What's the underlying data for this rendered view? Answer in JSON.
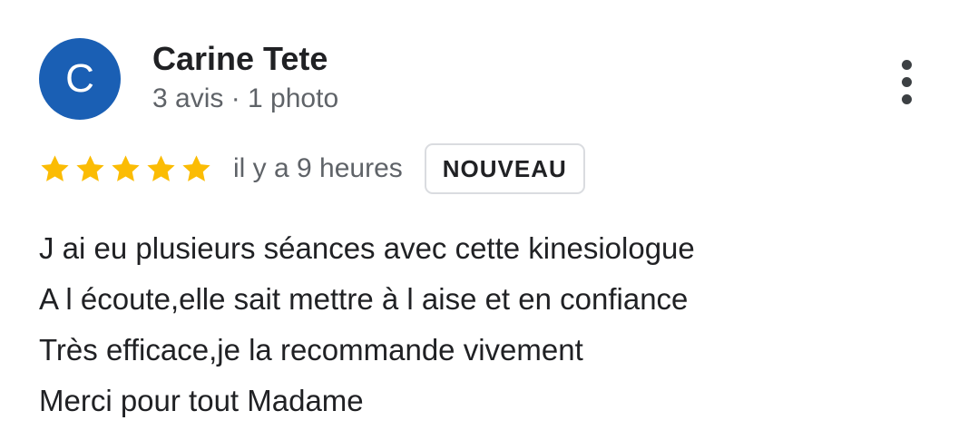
{
  "review": {
    "author": {
      "initial": "C",
      "name": "Carine Tete",
      "meta": "3 avis · 1 photo",
      "avatar_color": "#1a5fb4"
    },
    "menu_icon": "more-vert-icon",
    "rating": {
      "stars": 5,
      "max": 5,
      "star_color": "#fbbc04"
    },
    "date": "il y a 9 heures",
    "badge": "NOUVEAU",
    "text_lines": [
      "J ai eu plusieurs séances avec cette kinesiologue",
      "A l écoute,elle sait mettre à l aise et en confiance",
      "Très efficace,je la recommande vivement",
      "Merci pour tout Madame"
    ]
  }
}
